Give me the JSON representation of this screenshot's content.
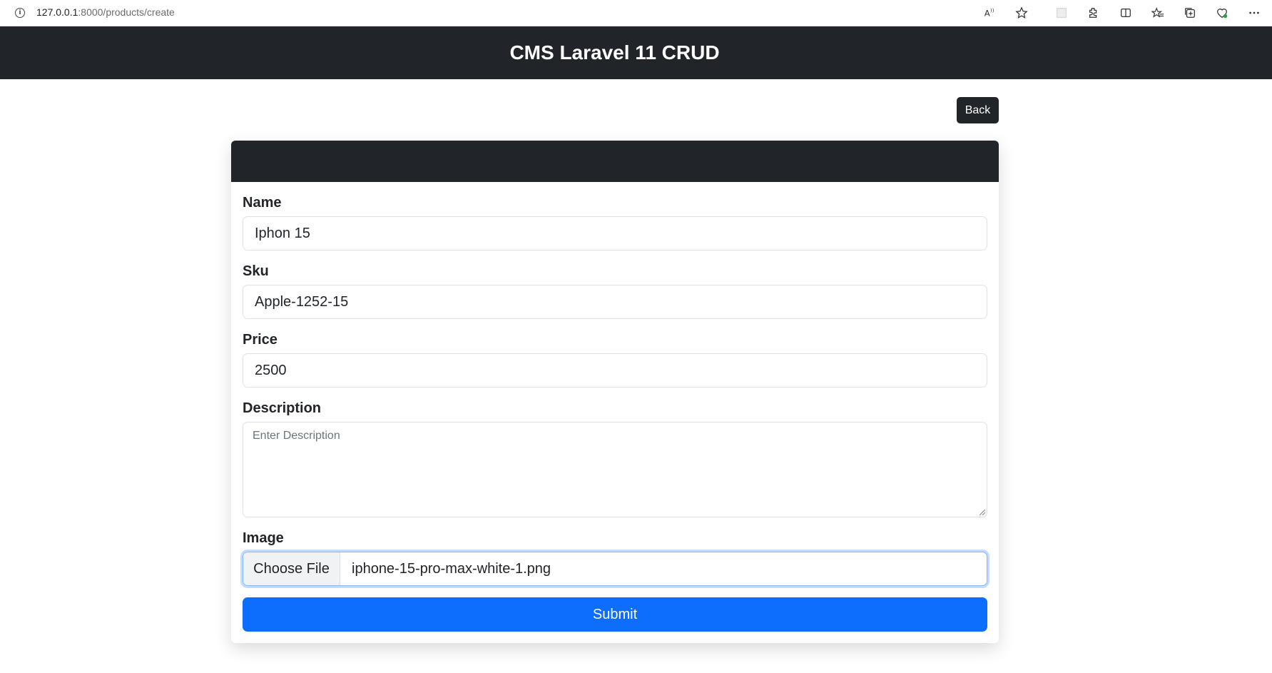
{
  "browser": {
    "url_host": "127.0.0.1",
    "url_path": ":8000/products/create",
    "icons": [
      "read-aloud-icon",
      "favorite-star-icon",
      "extension-placeholder-icon",
      "extensions-icon",
      "split-screen-icon",
      "favorites-icon",
      "collections-icon",
      "browser-essentials-icon",
      "more-menu-icon"
    ]
  },
  "header": {
    "title": "CMS Laravel 11 CRUD"
  },
  "actions": {
    "back_label": "Back"
  },
  "form": {
    "name": {
      "label": "Name",
      "value": "Iphon 15"
    },
    "sku": {
      "label": "Sku",
      "value": "Apple-1252-15"
    },
    "price": {
      "label": "Price",
      "value": "2500"
    },
    "description": {
      "label": "Description",
      "placeholder": "Enter Description",
      "value": ""
    },
    "image": {
      "label": "Image",
      "button_label": "Choose File",
      "file_name": "iphone-15-pro-max-white-1.png"
    },
    "submit_label": "Submit"
  },
  "colors": {
    "dark": "#212529",
    "primary": "#0d6efd",
    "focus_border": "#86b7fe"
  }
}
